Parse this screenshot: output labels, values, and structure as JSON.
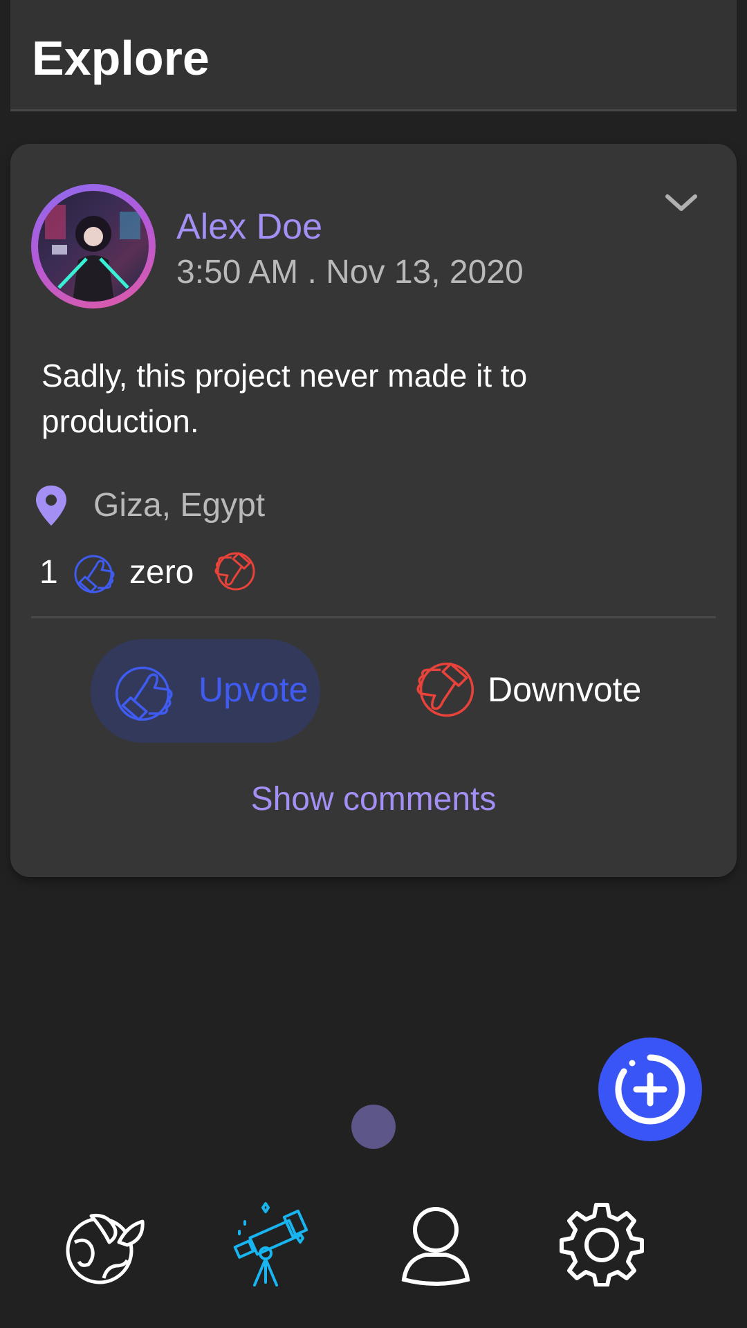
{
  "header": {
    "title": "Explore"
  },
  "post": {
    "author": "Alex Doe",
    "timestamp": "3:50 AM . Nov 13, 2020",
    "text": "Sadly, this project never made it to production.",
    "location": "Giza, Egypt",
    "upvote_count": "1",
    "downvote_count": "zero",
    "actions": {
      "upvote_label": "Upvote",
      "downvote_label": "Downvote",
      "show_comments_label": "Show comments"
    }
  },
  "icons": {
    "header": [],
    "post": [
      "chevron-down-icon",
      "map-pin-icon",
      "thumbs-up-icon",
      "thumbs-down-icon"
    ],
    "fab": "add-circle-icon",
    "bottom_nav": [
      "globe-leaf-icon",
      "telescope-icon",
      "person-icon",
      "gear-icon"
    ]
  },
  "colors": {
    "accent_purple": "#a48ff5",
    "upvote_blue": "#3f5bf0",
    "downvote_red": "#e8423a",
    "fab_blue": "#3a55f5",
    "active_nav": "#19b5f0"
  },
  "bottom_nav": {
    "active_index": 1
  }
}
